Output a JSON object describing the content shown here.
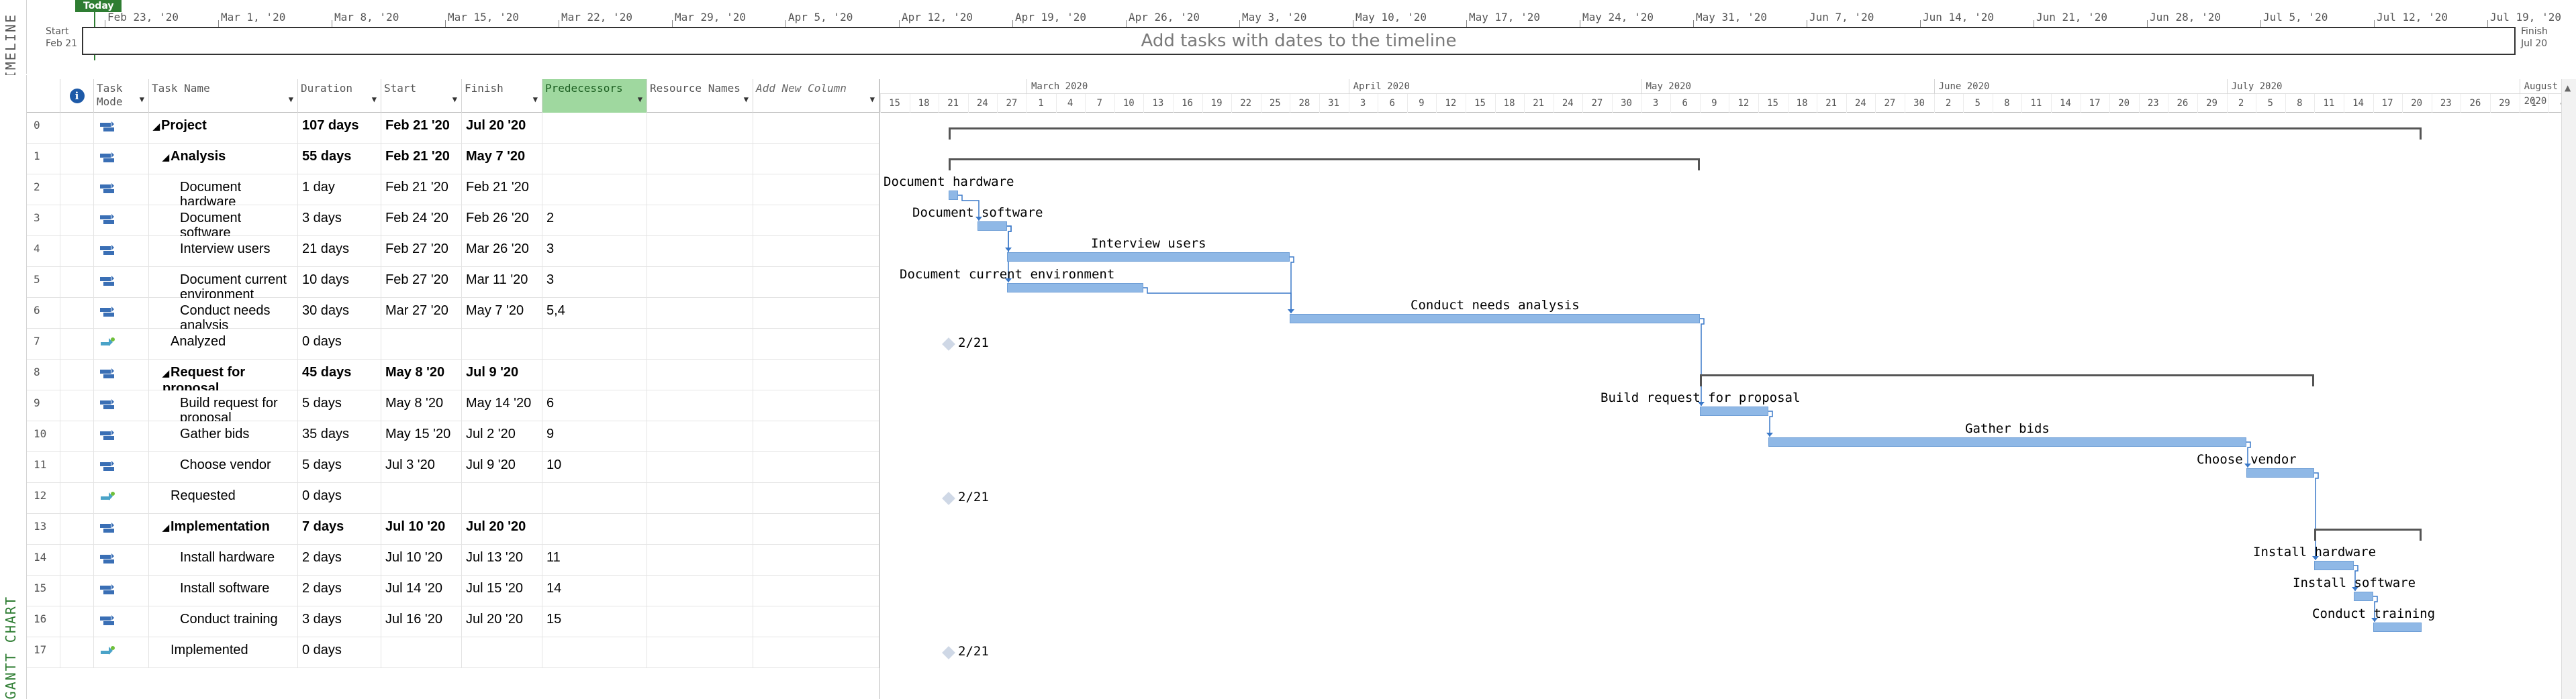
{
  "timeline": {
    "sidebar_label": "TIMELINE",
    "today": "Today",
    "start_label": "Start",
    "start_date": "Feb 21",
    "finish_label": "Finish",
    "finish_date": "Jul 20",
    "placeholder": "Add tasks with dates to the timeline",
    "ticks": [
      "Feb 23, '20",
      "Mar 1, '20",
      "Mar 8, '20",
      "Mar 15, '20",
      "Mar 22, '20",
      "Mar 29, '20",
      "Apr 5, '20",
      "Apr 12, '20",
      "Apr 19, '20",
      "Apr 26, '20",
      "May 3, '20",
      "May 10, '20",
      "May 17, '20",
      "May 24, '20",
      "May 31, '20",
      "Jun 7, '20",
      "Jun 14, '20",
      "Jun 21, '20",
      "Jun 28, '20",
      "Jul 5, '20",
      "Jul 12, '20",
      "Jul 19, '20"
    ]
  },
  "gantt": {
    "sidebar_label": "GANTT CHART",
    "columns": {
      "task_mode": "Task Mode",
      "task_name": "Task Name",
      "duration": "Duration",
      "start": "Start",
      "finish": "Finish",
      "predecessors": "Predecessors",
      "resource_names": "Resource Names",
      "add_column": "Add New Column"
    },
    "rows": [
      {
        "id": "0",
        "name": "Project",
        "duration": "107 days",
        "start": "Feb 21 '20",
        "finish": "Jul 20 '20",
        "pred": "",
        "bold": true,
        "level": 0,
        "summary": true,
        "manual": false
      },
      {
        "id": "1",
        "name": "Analysis",
        "duration": "55 days",
        "start": "Feb 21 '20",
        "finish": "May 7 '20",
        "pred": "",
        "bold": true,
        "level": 1,
        "summary": true,
        "manual": false
      },
      {
        "id": "2",
        "name": "Document hardware",
        "duration": "1 day",
        "start": "Feb 21 '20",
        "finish": "Feb 21 '20",
        "pred": "",
        "bold": false,
        "level": 2,
        "summary": false,
        "manual": false
      },
      {
        "id": "3",
        "name": "Document software",
        "duration": "3 days",
        "start": "Feb 24 '20",
        "finish": "Feb 26 '20",
        "pred": "2",
        "bold": false,
        "level": 2,
        "summary": false,
        "manual": false
      },
      {
        "id": "4",
        "name": "Interview users",
        "duration": "21 days",
        "start": "Feb 27 '20",
        "finish": "Mar 26 '20",
        "pred": "3",
        "bold": false,
        "level": 2,
        "summary": false,
        "manual": false
      },
      {
        "id": "5",
        "name": "Document current environment",
        "duration": "10 days",
        "start": "Feb 27 '20",
        "finish": "Mar 11 '20",
        "pred": "3",
        "bold": false,
        "level": 2,
        "summary": false,
        "manual": false
      },
      {
        "id": "6",
        "name": "Conduct needs analysis",
        "duration": "30 days",
        "start": "Mar 27 '20",
        "finish": "May 7 '20",
        "pred": "5,4",
        "bold": false,
        "level": 2,
        "summary": false,
        "manual": false
      },
      {
        "id": "7",
        "name": "Analyzed",
        "duration": "0 days",
        "start": "",
        "finish": "",
        "pred": "",
        "bold": false,
        "level": 1,
        "summary": false,
        "manual": true
      },
      {
        "id": "8",
        "name": "Request for proposal",
        "duration": "45 days",
        "start": "May 8 '20",
        "finish": "Jul 9 '20",
        "pred": "",
        "bold": true,
        "level": 1,
        "summary": true,
        "manual": false
      },
      {
        "id": "9",
        "name": "Build request for proposal",
        "duration": "5 days",
        "start": "May 8 '20",
        "finish": "May 14 '20",
        "pred": "6",
        "bold": false,
        "level": 2,
        "summary": false,
        "manual": false
      },
      {
        "id": "10",
        "name": "Gather bids",
        "duration": "35 days",
        "start": "May 15 '20",
        "finish": "Jul 2 '20",
        "pred": "9",
        "bold": false,
        "level": 2,
        "summary": false,
        "manual": false
      },
      {
        "id": "11",
        "name": "Choose vendor",
        "duration": "5 days",
        "start": "Jul 3 '20",
        "finish": "Jul 9 '20",
        "pred": "10",
        "bold": false,
        "level": 2,
        "summary": false,
        "manual": false
      },
      {
        "id": "12",
        "name": "Requested",
        "duration": "0 days",
        "start": "",
        "finish": "",
        "pred": "",
        "bold": false,
        "level": 1,
        "summary": false,
        "manual": true
      },
      {
        "id": "13",
        "name": "Implementation",
        "duration": "7 days",
        "start": "Jul 10 '20",
        "finish": "Jul 20 '20",
        "pred": "",
        "bold": true,
        "level": 1,
        "summary": true,
        "manual": false
      },
      {
        "id": "14",
        "name": "Install hardware",
        "duration": "2 days",
        "start": "Jul 10 '20",
        "finish": "Jul 13 '20",
        "pred": "11",
        "bold": false,
        "level": 2,
        "summary": false,
        "manual": false
      },
      {
        "id": "15",
        "name": "Install software",
        "duration": "2 days",
        "start": "Jul 14 '20",
        "finish": "Jul 15 '20",
        "pred": "14",
        "bold": false,
        "level": 2,
        "summary": false,
        "manual": false
      },
      {
        "id": "16",
        "name": "Conduct training",
        "duration": "3 days",
        "start": "Jul 16 '20",
        "finish": "Jul 20 '20",
        "pred": "15",
        "bold": false,
        "level": 2,
        "summary": false,
        "manual": false
      },
      {
        "id": "17",
        "name": "Implemented",
        "duration": "0 days",
        "start": "",
        "finish": "",
        "pred": "",
        "bold": false,
        "level": 1,
        "summary": false,
        "manual": true
      }
    ]
  },
  "chart": {
    "months": [
      "March 2020",
      "April 2020",
      "May 2020",
      "June 2020",
      "July 2020",
      "August 2020"
    ],
    "days": [
      "15",
      "18",
      "21",
      "24",
      "27",
      "1",
      "4",
      "7",
      "10",
      "13",
      "16",
      "19",
      "22",
      "25",
      "28",
      "31",
      "3",
      "6",
      "9",
      "12",
      "15",
      "18",
      "21",
      "24",
      "27",
      "30",
      "3",
      "6",
      "9",
      "12",
      "15",
      "18",
      "21",
      "24",
      "27",
      "30",
      "2",
      "5",
      "8",
      "11",
      "14",
      "17",
      "20",
      "23",
      "26",
      "29",
      "2",
      "5",
      "8",
      "11",
      "14",
      "17",
      "20",
      "23",
      "26",
      "29",
      "1",
      "4"
    ],
    "milestone_label": "2/21"
  }
}
